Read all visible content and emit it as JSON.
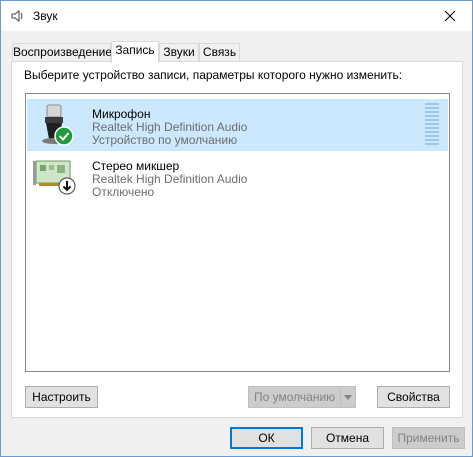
{
  "window": {
    "title": "Звук",
    "close_icon": "close-icon"
  },
  "tabs": [
    {
      "label": "Воспроизведение",
      "active": false
    },
    {
      "label": "Запись",
      "active": true
    },
    {
      "label": "Звуки",
      "active": false
    },
    {
      "label": "Связь",
      "active": false
    }
  ],
  "instruction": "Выберите устройство записи, параметры которого нужно изменить:",
  "devices": [
    {
      "name": "Микрофон",
      "driver": "Realtek High Definition Audio",
      "status": "Устройство по умолчанию",
      "icon": "microphone-icon",
      "badge": "default-check-icon",
      "selected": true
    },
    {
      "name": "Стерео микшер",
      "driver": "Realtek High Definition Audio",
      "status": "Отключено",
      "icon": "sound-card-icon",
      "badge": "disabled-arrow-icon",
      "selected": false
    }
  ],
  "buttons": {
    "configure": "Настроить",
    "set_default": "По умолчанию",
    "properties": "Свойства",
    "ok": "ОК",
    "cancel": "Отмена",
    "apply": "Применить"
  },
  "colors": {
    "selection": "#cce8ff",
    "accent": "#0078d7",
    "check_badge": "#1e9b3c"
  }
}
